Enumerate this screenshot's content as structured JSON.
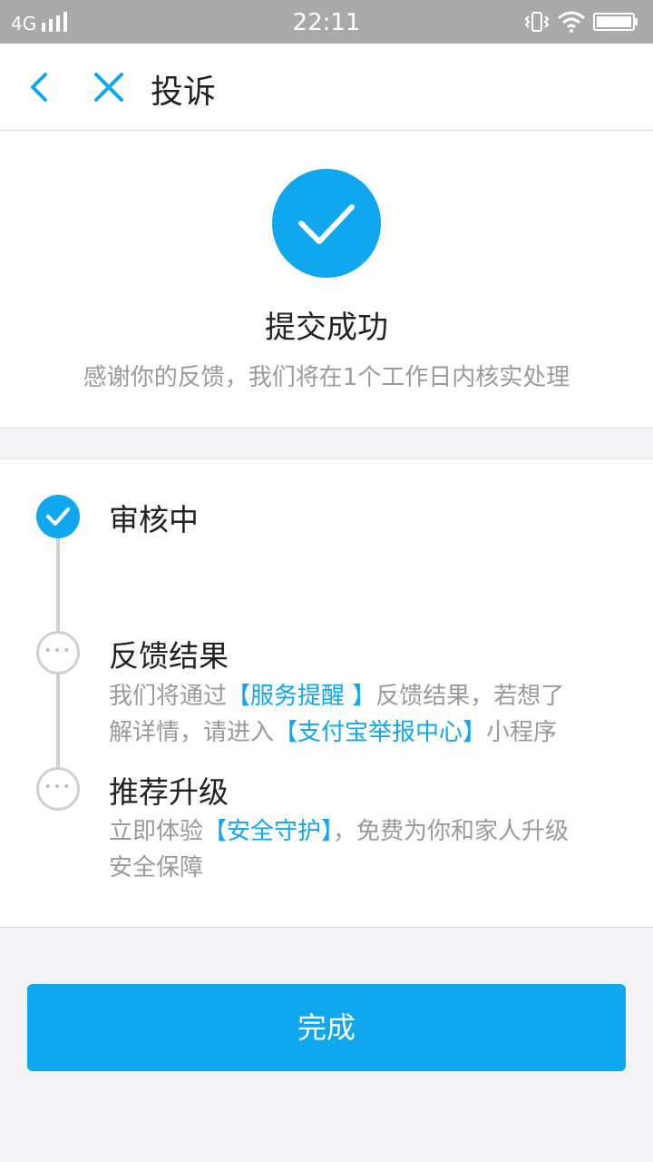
{
  "status_bar": {
    "network": "4G",
    "time": "22:11"
  },
  "navbar": {
    "title": "投诉"
  },
  "result": {
    "title": "提交成功",
    "description": "感谢你的反馈，我们将在1个工作日内核实处理"
  },
  "steps": [
    {
      "title": "审核中",
      "state": "done"
    },
    {
      "title": "反馈结果",
      "state": "pending",
      "desc_line1_pre": "我们将通过",
      "desc_line1_link": "【服务提醒 】",
      "desc_line1_post": "反馈结果，若想了",
      "desc_line2_pre": "解详情，请进入",
      "desc_line2_link": "【支付宝举报中心】",
      "desc_line2_post": "小程序"
    },
    {
      "title": "推荐升级",
      "state": "pending",
      "desc_line1_pre": "立即体验",
      "desc_line1_link": "【安全守护】",
      "desc_line1_post": "，免费为你和家人升级",
      "desc_line2_pre": "安全保障"
    }
  ],
  "pending_dots": "•••",
  "done_button": "完成",
  "colors": {
    "accent": "#0fa8ee",
    "status_bar": "#a9a9a9",
    "text_primary": "#222222",
    "text_secondary": "#9a9a9a",
    "timeline": "#d0d0d0"
  }
}
